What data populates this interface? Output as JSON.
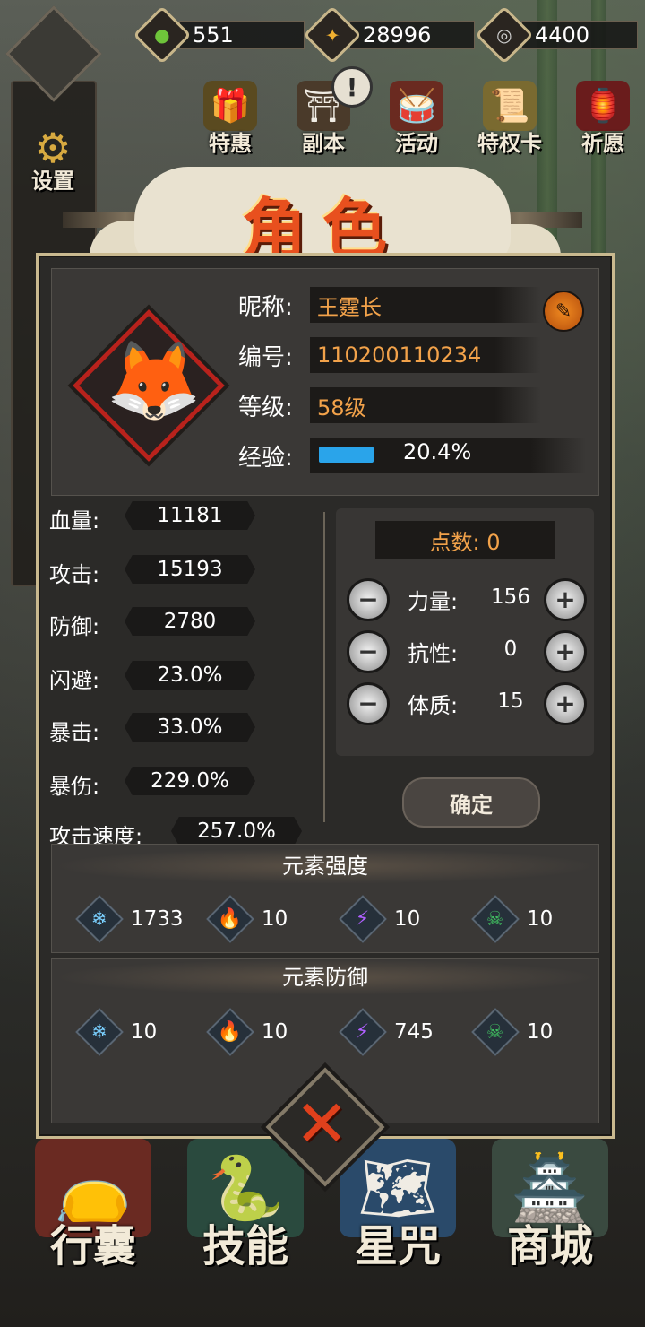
{
  "currencies": [
    {
      "icon": "green-drop-icon",
      "glyph": "●",
      "color": "#6ec43a",
      "value": "551"
    },
    {
      "icon": "gold-coin-icon",
      "glyph": "✦",
      "color": "#f0b030",
      "value": "28996"
    },
    {
      "icon": "silver-coin-icon",
      "glyph": "◎",
      "color": "#cfcfcf",
      "value": "4400"
    }
  ],
  "left_menu": {
    "settings_label": "设置"
  },
  "top_icons": [
    {
      "name": "special-offer",
      "label": "特惠",
      "glyph": "🎁"
    },
    {
      "name": "dungeon",
      "label": "副本",
      "glyph": "⛩",
      "alert": "!"
    },
    {
      "name": "event",
      "label": "活动",
      "glyph": "🥁"
    },
    {
      "name": "privilege-card",
      "label": "特权卡",
      "glyph": "📜"
    },
    {
      "name": "wish",
      "label": "祈愿",
      "glyph": "🏮"
    }
  ],
  "title": "角色",
  "profile": {
    "nickname_label": "昵称:",
    "nickname": "王霆长",
    "id_label": "编号:",
    "id": "110200110234",
    "level_label": "等级:",
    "level": "58级",
    "exp_label": "经验:",
    "exp_text": "20.4%",
    "exp_fraction": 0.204,
    "edit_glyph": "✎"
  },
  "stats": [
    {
      "label": "血量:",
      "value": "11181"
    },
    {
      "label": "攻击:",
      "value": "15193"
    },
    {
      "label": "防御:",
      "value": "2780"
    },
    {
      "label": "闪避:",
      "value": "23.0%"
    },
    {
      "label": "暴击:",
      "value": "33.0%"
    },
    {
      "label": "暴伤:",
      "value": "229.0%"
    },
    {
      "label": "攻击速度:",
      "value": "257.0%"
    }
  ],
  "points": {
    "label": "点数: 0",
    "minus": "−",
    "plus": "+",
    "attributes": [
      {
        "label": "力量:",
        "value": "156"
      },
      {
        "label": "抗性:",
        "value": "0"
      },
      {
        "label": "体质:",
        "value": "15"
      }
    ],
    "confirm": "确定"
  },
  "element_strength": {
    "title": "元素强度",
    "items": [
      {
        "icon": "ice-icon",
        "glyph": "❄",
        "color": "#7ad0ff",
        "value": "1733"
      },
      {
        "icon": "fire-icon",
        "glyph": "🔥",
        "color": "#ff8a20",
        "value": "10"
      },
      {
        "icon": "lightning-icon",
        "glyph": "⚡",
        "color": "#b060ff",
        "value": "10"
      },
      {
        "icon": "poison-skull-icon",
        "glyph": "☠",
        "color": "#40c060",
        "value": "10"
      }
    ]
  },
  "element_defense": {
    "title": "元素防御",
    "items": [
      {
        "icon": "ice-icon",
        "glyph": "❄",
        "color": "#7ad0ff",
        "value": "10"
      },
      {
        "icon": "fire-icon",
        "glyph": "🔥",
        "color": "#ff8a20",
        "value": "10"
      },
      {
        "icon": "lightning-icon",
        "glyph": "⚡",
        "color": "#b060ff",
        "value": "745"
      },
      {
        "icon": "poison-skull-icon",
        "glyph": "☠",
        "color": "#40c060",
        "value": "10"
      }
    ]
  },
  "close_glyph": "✕",
  "bottom_nav": [
    {
      "name": "bag",
      "label": "行囊",
      "glyph": "👝"
    },
    {
      "name": "skills",
      "label": "技能",
      "glyph": "🐍"
    },
    {
      "name": "star-curse",
      "label": "星咒",
      "glyph": "🗺"
    },
    {
      "name": "shop",
      "label": "商城",
      "glyph": "🏯"
    }
  ]
}
